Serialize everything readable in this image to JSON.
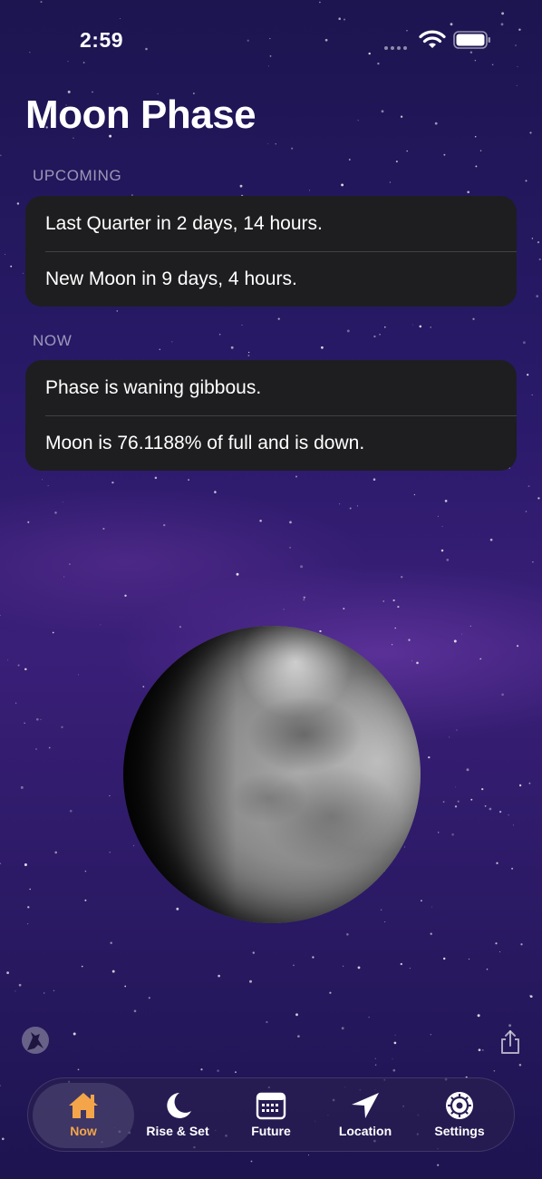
{
  "status_bar": {
    "time": "2:59"
  },
  "title": "Moon Phase",
  "upcoming": {
    "header": "UPCOMING",
    "rows": [
      "Last Quarter in 2 days, 14 hours.",
      "New Moon in 9 days, 4 hours."
    ]
  },
  "now": {
    "header": "NOW",
    "rows": [
      "Phase is waning gibbous.",
      "Moon is 76.1188% of full and is down."
    ]
  },
  "tabs": [
    {
      "label": "Now",
      "icon": "house-icon",
      "active": true
    },
    {
      "label": "Rise & Set",
      "icon": "crescent-moon-icon",
      "active": false
    },
    {
      "label": "Future",
      "icon": "calendar-icon",
      "active": false
    },
    {
      "label": "Location",
      "icon": "location-arrow-icon",
      "active": false
    },
    {
      "label": "Settings",
      "icon": "gear-icon",
      "active": false
    }
  ],
  "colors": {
    "accent": "#f4a54a",
    "card_bg": "#1e1e20",
    "background": "#2a1a6a"
  }
}
